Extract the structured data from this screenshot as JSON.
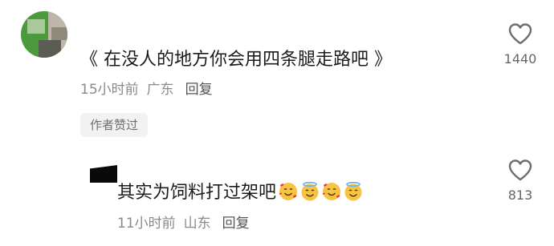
{
  "comment": {
    "text": "《 在没人的地方你会用四条腿走路吧 》",
    "time": "15小时前",
    "location": "广东",
    "reply_label": "回复",
    "badge": "作者赞过",
    "like_count": "1440"
  },
  "reply": {
    "text": "其实为饲料打过架吧",
    "emojis": [
      "smiling-face-with-hearts-icon",
      "smiling-face-with-halo-icon",
      "smiling-face-with-hearts-icon",
      "smiling-face-with-halo-icon"
    ],
    "time": "11小时前",
    "location": "山东",
    "reply_label": "回复",
    "like_count": "813"
  },
  "colors": {
    "text": "#1c1c1c",
    "meta": "#8a8a8a",
    "badge_bg": "#f2f2f2",
    "heart_stroke": "#6e6e6e",
    "emoji_face": "#f6c343",
    "emoji_heart": "#e8333b",
    "emoji_halo": "#6fb7ea"
  }
}
